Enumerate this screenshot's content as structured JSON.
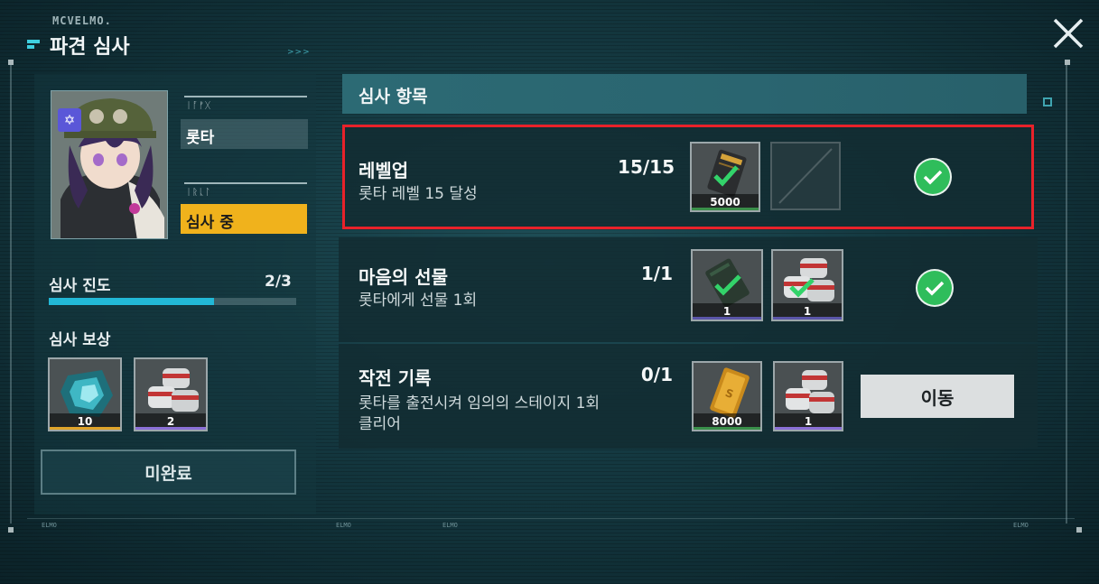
{
  "header": {
    "brand": "MCVELMO.",
    "title": "파견 심사",
    "chevrons": ">>>"
  },
  "footer": {
    "left_mark": "ELMO",
    "center_mark": "ELMO",
    "center_mark2": "ELMO",
    "right_mark": "ELMO"
  },
  "character": {
    "name_tag": "ᛁᚪᚠᚷ",
    "name": "롯타",
    "status_tag": "ᛁᚱᚳᛚ",
    "status": "심사 중",
    "role_icon": "star-of-david-icon"
  },
  "progress": {
    "label": "심사 진도",
    "count": "2/3",
    "fraction": 0.667,
    "color": "#22b8d6"
  },
  "rewards": {
    "label": "심사 보상",
    "items": [
      {
        "icon": "crystal-icon",
        "qty": "10",
        "rarity_color": "#e0a42a"
      },
      {
        "icon": "canister-icon",
        "qty": "2",
        "rarity_color": "#8b6fd6"
      }
    ]
  },
  "incomplete_button": "미완료",
  "section": {
    "title": "심사 항목"
  },
  "tasks": [
    {
      "title": "레벨업",
      "desc": "롯타 레벨 15 달성",
      "count": "15/15",
      "completed": true,
      "items": [
        {
          "icon": "card-icon",
          "qty": "5000",
          "rarity_color": "#3a8f4a"
        }
      ]
    },
    {
      "title": "마음의 선물",
      "desc": "롯타에게 선물 1회",
      "count": "1/1",
      "completed": true,
      "items": [
        {
          "icon": "card-icon",
          "qty": "1",
          "rarity_color": "#5a55a8"
        },
        {
          "icon": "canister-icon",
          "qty": "1",
          "rarity_color": "#5a55a8"
        }
      ]
    },
    {
      "title": "작전 기록",
      "desc": "롯타를 출전시켜 임의의 스테이지 1회 클리어",
      "desc_line1": "롯타를 출전시켜 임의의 스테이지 1회",
      "desc_line2": "클리어",
      "count": "0/1",
      "completed": false,
      "action": "이동",
      "items": [
        {
          "icon": "gold-bar-icon",
          "qty": "8000",
          "rarity_color": "#3a8f4a"
        },
        {
          "icon": "canister-icon",
          "qty": "1",
          "rarity_color": "#8b6fd6"
        }
      ]
    }
  ],
  "colors": {
    "accent": "#3fd0e0",
    "status_yellow": "#f0b21c",
    "check_green": "#2fbd5b",
    "selected_border": "#e8222a"
  }
}
